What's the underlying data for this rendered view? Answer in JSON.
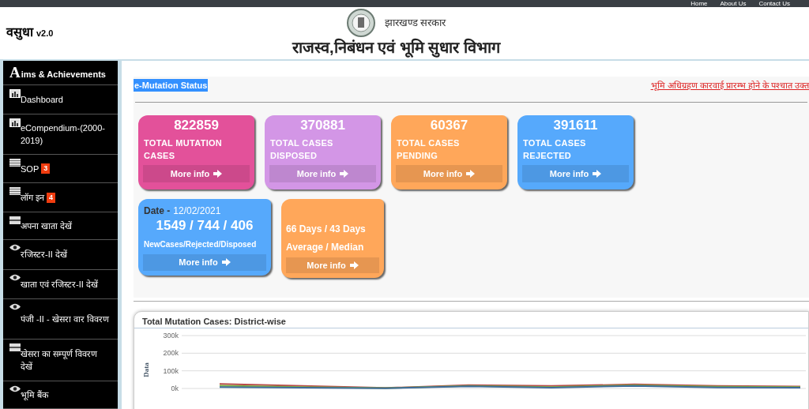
{
  "top_links": [
    "Home",
    "About Us",
    "Contact Us"
  ],
  "header": {
    "app_name": "वसुधा",
    "version": "v2.0",
    "government": "झारखण्ड सरकार",
    "department": "राजस्व,निबंधन एवं भूमि सुधार  विभाग"
  },
  "sidebar": {
    "items": [
      {
        "kind": "heading",
        "label": "Aims & Achievements"
      },
      {
        "kind": "report",
        "label": "Dashboard"
      },
      {
        "kind": "report",
        "label": "eCompendium-(2000-2019)"
      },
      {
        "kind": "document",
        "label": "SOP",
        "badge": "3"
      },
      {
        "kind": "document",
        "label": "लॉग इन",
        "badge": "4"
      },
      {
        "kind": "account",
        "label": "अपना खाता देखें"
      },
      {
        "kind": "view",
        "label": "रजिस्टर-II देखें"
      },
      {
        "kind": "view",
        "label": "खाता एवं रजिस्टर-II देखें"
      },
      {
        "kind": "view",
        "label": "पंजी -II - खेसरा वार विवरण"
      },
      {
        "kind": "account",
        "label": "खेसरा का सम्पूर्ण विवरण देखें"
      },
      {
        "kind": "view",
        "label": "भूमि बैंक"
      }
    ]
  },
  "section_title": "e-Mutation Status",
  "notice": "भूमि अधिग्रहण कारवाई प्रारम्भ होने के पश्चात उक्त",
  "cards": [
    {
      "kind": "count",
      "color": "#e3519a",
      "value": "822859",
      "label": "TOTAL MUTATION CASES",
      "link": "More info"
    },
    {
      "kind": "count",
      "color": "#d396e6",
      "value": "370881",
      "label": "TOTAL CASES DISPOSED",
      "link": "More info"
    },
    {
      "kind": "count",
      "color": "#ffa75a",
      "value": "60367",
      "label": "TOTAL CASES PENDING",
      "link": "More info"
    },
    {
      "kind": "count",
      "color": "#56a9fc",
      "value": "391611",
      "label": "TOTAL CASES REJECTED",
      "link": "More info"
    },
    {
      "kind": "daily",
      "color": "#56a9fc",
      "date_label": "Date -",
      "date": "12/02/2021",
      "value": "1549 / 744 / 406",
      "label": "NewCases/Rejected/Disposed",
      "link": "More info"
    },
    {
      "kind": "duration",
      "color": "#ffa75a",
      "value": "66 Days / 43 Days",
      "label": "Average / Median",
      "link": "More info"
    }
  ],
  "chart": {
    "title": "Total Mutation Cases: District-wise",
    "chart_data": {
      "type": "line",
      "ylabel": "Data",
      "ylim": [
        0,
        300000
      ],
      "yticks": [
        {
          "value": 0,
          "label": "0k"
        },
        {
          "value": 100000,
          "label": "100k"
        },
        {
          "value": 200000,
          "label": "200k"
        },
        {
          "value": 300000,
          "label": "300k"
        }
      ],
      "series": [
        {
          "color": "#b94a48",
          "values": [
            26000,
            15000,
            3000,
            19000,
            14000,
            23000,
            14000,
            11000
          ]
        },
        {
          "color": "#7cb342",
          "values": [
            16000,
            8000,
            2000,
            15000,
            8000,
            18000,
            10000,
            8000
          ]
        },
        {
          "color": "#3d6b9a",
          "values": [
            8000,
            5000,
            1000,
            12000,
            4000,
            15000,
            6000,
            5000
          ]
        }
      ]
    }
  }
}
